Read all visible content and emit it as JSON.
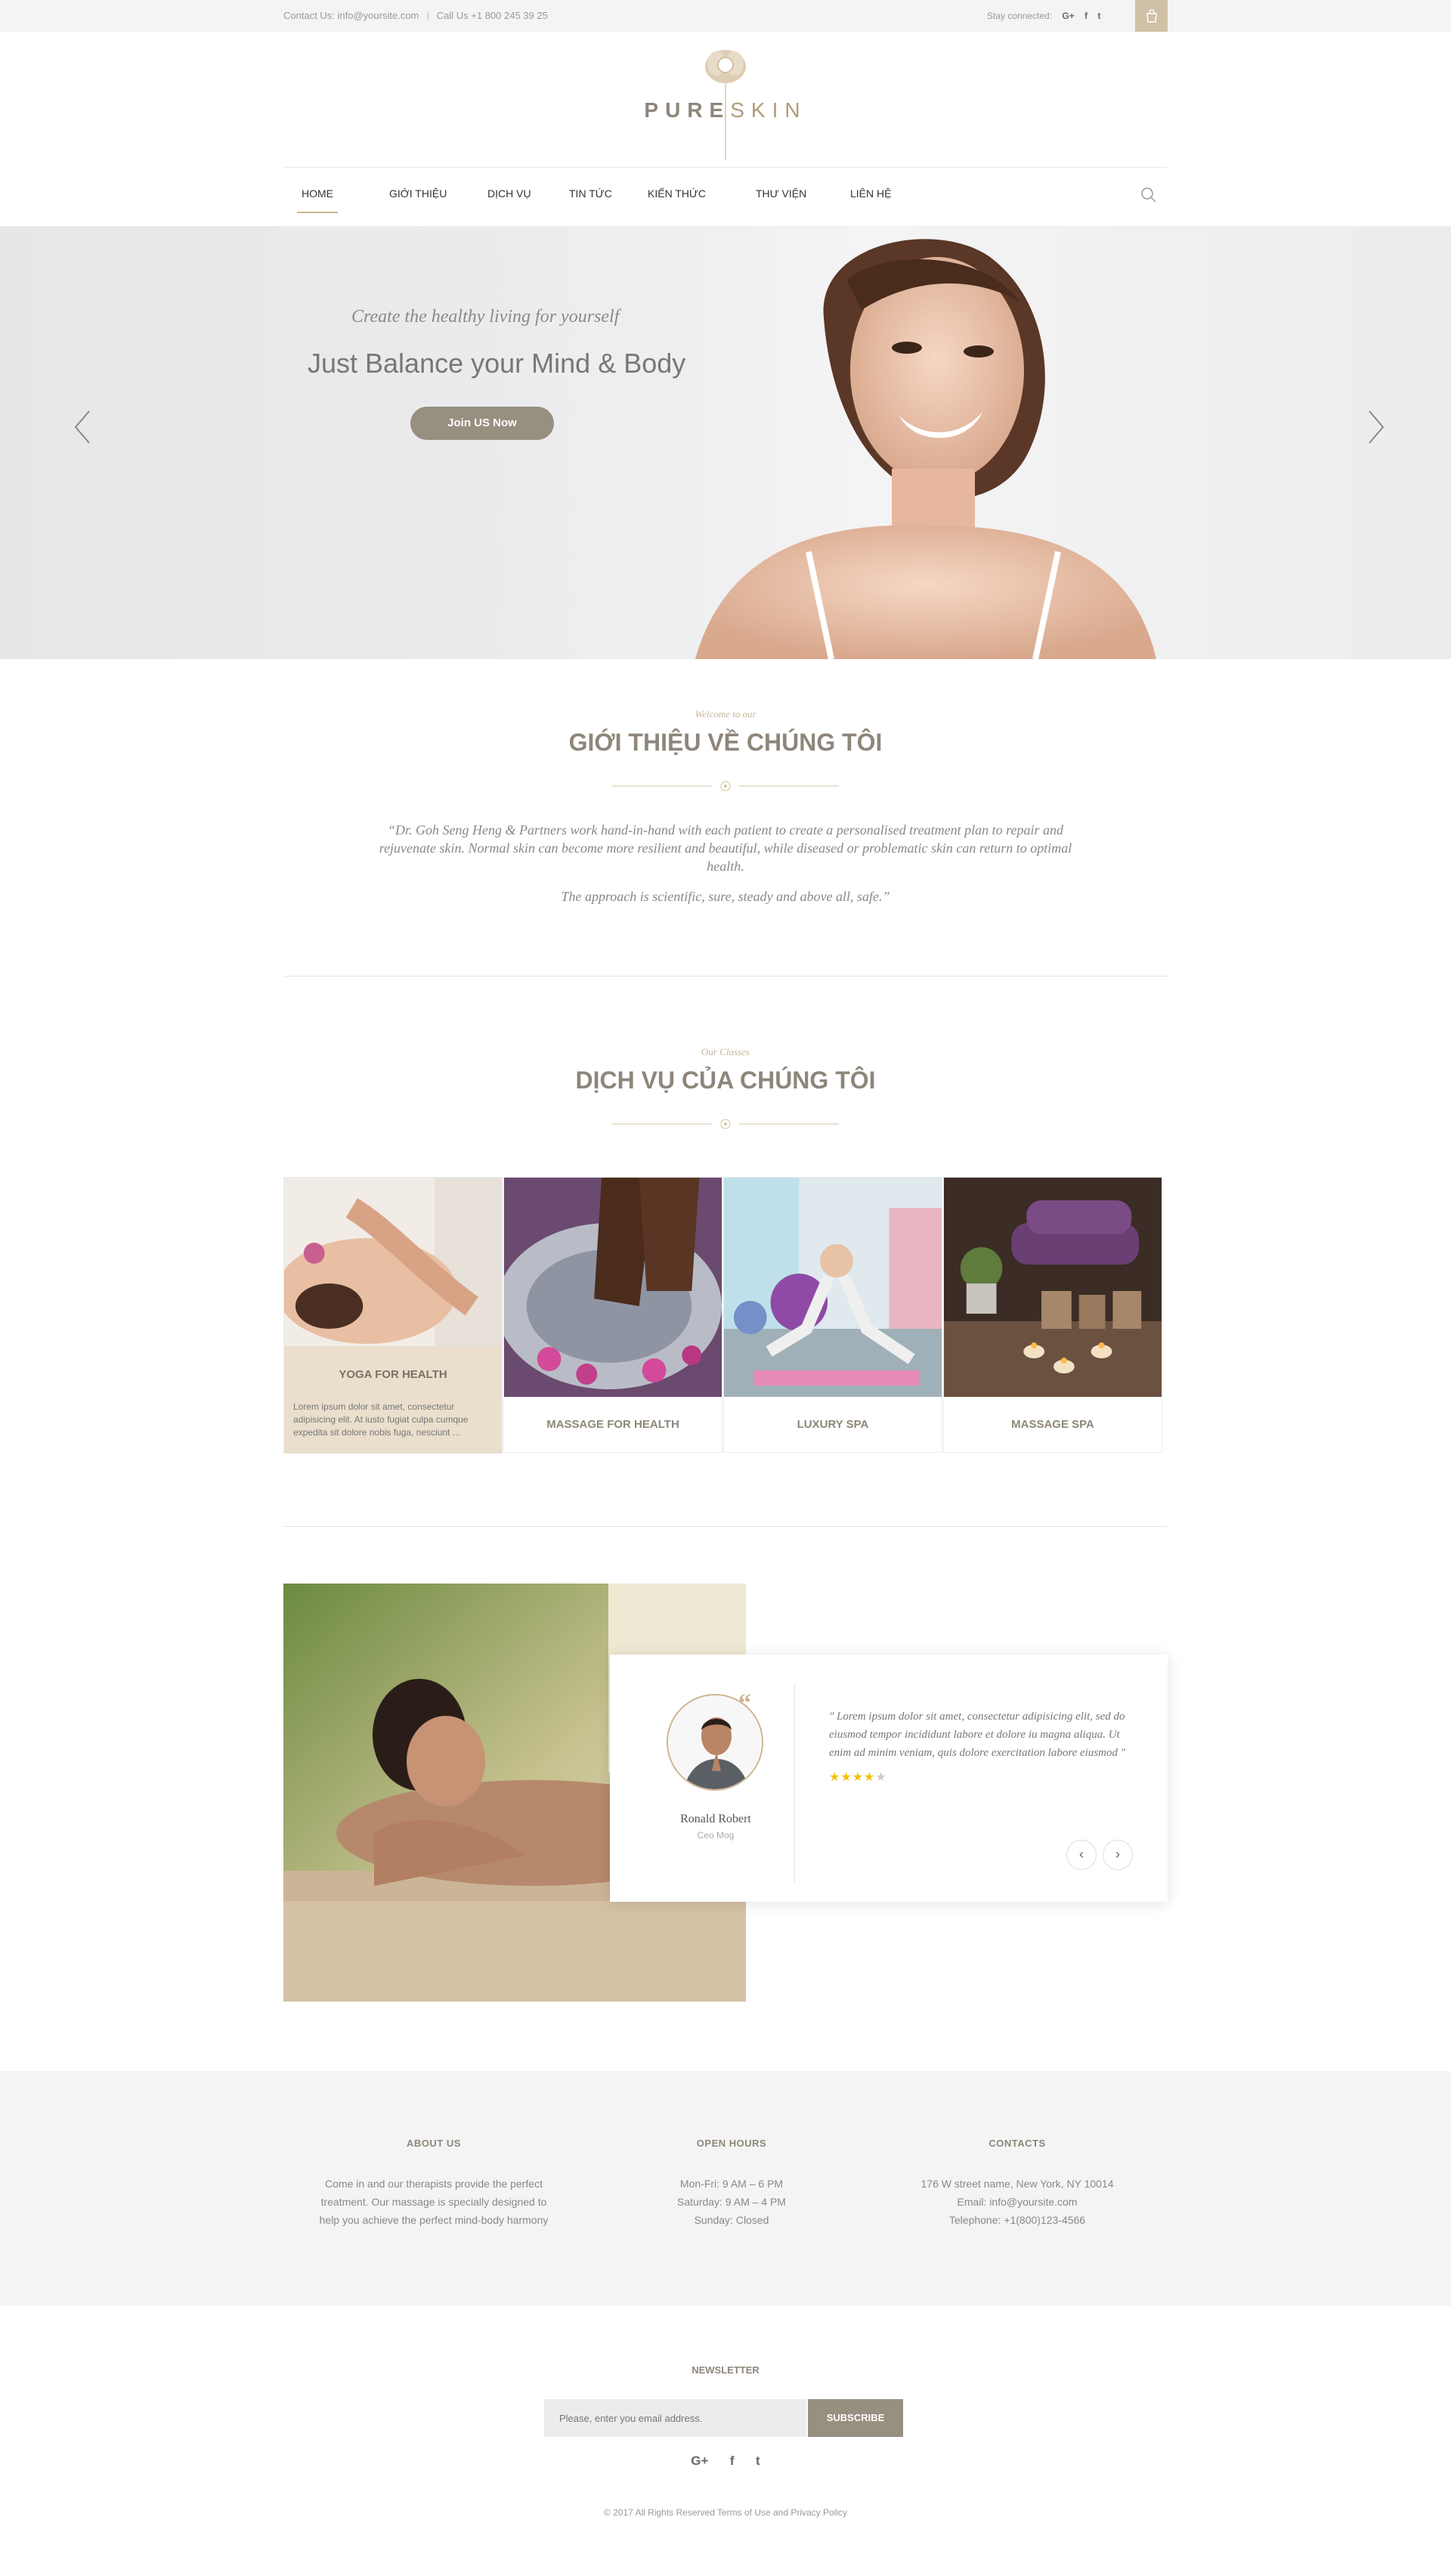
{
  "topbar": {
    "contact": "Contact Us: info@yoursite.com",
    "phone": "Call Us +1 800 245 39 25",
    "stay_connected": "Stay connected:",
    "social": [
      "G+",
      "f",
      "t"
    ]
  },
  "logo": {
    "pure": "PURE",
    "skin": "SKIN"
  },
  "nav": {
    "items": [
      "HOME",
      "GIỚI THIỆU",
      "DỊCH VỤ",
      "TIN TỨC",
      "KIẾN THỨC",
      "THƯ VIỆN",
      "LIÊN HỆ"
    ],
    "active_index": 0
  },
  "hero": {
    "subtitle": "Create the healthy living for yourself",
    "title": "Just Balance your Mind & Body",
    "button": "Join US Now"
  },
  "about": {
    "eyebrow": "Welcome to our",
    "title": "GIỚI THIỆU VỀ CHÚNG TÔI",
    "quote": "“Dr. Goh Seng Heng & Partners work hand-in-hand with each patient to create a personalised treatment plan to repair and rejuvenate skin. Normal skin can become more resilient and beautiful, while diseased or problematic skin can return to optimal health.",
    "quote2": "The approach is scientific, sure, steady and above all, safe.”"
  },
  "services": {
    "eyebrow": "Our Classes",
    "title": "DỊCH VỤ CỦA CHÚNG TÔI",
    "items": [
      {
        "name": "YOGA FOR HEALTH",
        "desc": "Lorem ipsum dolor sit amet, consectetur adipisicing elit. At iusto fugiat culpa cumque expedita sit dolore nobis fuga, nesciunt ..."
      },
      {
        "name": "MASSAGE FOR HEALTH"
      },
      {
        "name": "LUXURY SPA"
      },
      {
        "name": "MASSAGE SPA"
      }
    ]
  },
  "testimonial": {
    "text": "\" Lorem ipsum dolor sit amet, consectetur adipisicing elit, sed do eiusmod tempor incididunt labore et dolore iu magna aliqua. Ut enim ad minim veniam, quis dolore exercitation labore eiusmod \"",
    "rating": 4,
    "max_rating": 5,
    "name": "Ronald Robert",
    "role": "Ceo Mog"
  },
  "footer": {
    "about": {
      "title": "ABOUT US",
      "lines": [
        "Come in and our therapists provide the perfect",
        "treatment. Our massage is specially designed to",
        "help you achieve the perfect mind-body harmony"
      ]
    },
    "hours": {
      "title": "OPEN HOURS",
      "lines": [
        "Mon-Fri: 9 AM – 6 PM",
        "Saturday: 9 AM – 4 PM",
        "Sunday: Closed"
      ]
    },
    "contacts": {
      "title": "CONTACTS",
      "lines": [
        "176 W street name, New York, NY 10014",
        "Email: info@yoursite.com",
        "Telephone: +1(800)123-4566"
      ]
    }
  },
  "newsletter": {
    "title": "NEWSLETTER",
    "placeholder": "Please, enter you email address.",
    "button": "SUBSCRIBE",
    "social": [
      "G+",
      "f",
      "t"
    ]
  },
  "copyright": "© 2017 All Rights Reserved Terms of Use and Privacy Policy",
  "colors": {
    "accent": "#cfb58d",
    "brand_dark": "#8e867a",
    "button": "#978f80",
    "panel": "#e9dfcc"
  }
}
